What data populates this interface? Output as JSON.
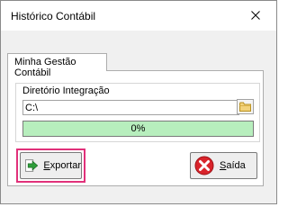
{
  "window": {
    "title": "Histórico Contábil",
    "close_icon": "close-icon"
  },
  "tabs": [
    {
      "label": "Minha Gestão Contábil",
      "active": true
    }
  ],
  "directory": {
    "label": "Diretório Integração",
    "value": "C:\\",
    "browse_icon": "folder-icon"
  },
  "progress": {
    "value": 0,
    "text": "0%",
    "fill_color": "#b7eebd"
  },
  "buttons": {
    "export": {
      "mnemonic": "E",
      "rest": "xportar",
      "icon": "export-arrow-icon",
      "highlight_color": "#e1317a"
    },
    "exit": {
      "mnemonic": "S",
      "rest": "aída",
      "icon": "exit-x-icon",
      "icon_color": "#d9242b"
    }
  }
}
